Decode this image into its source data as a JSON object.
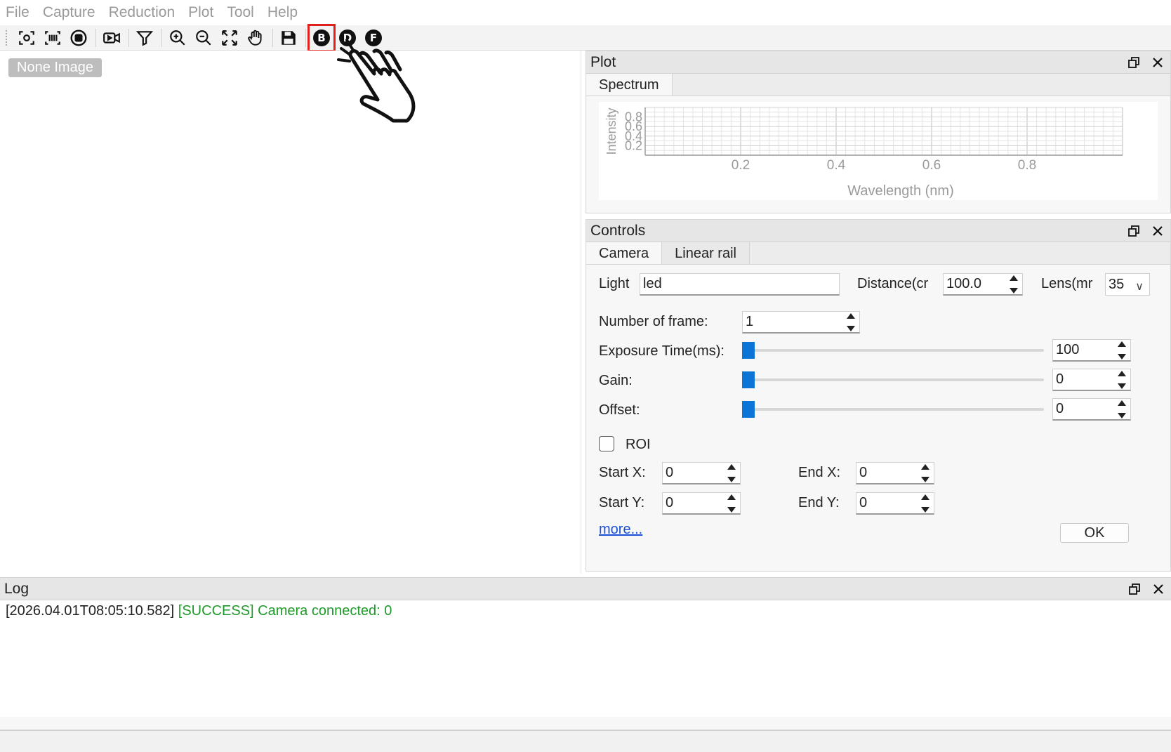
{
  "menu": [
    "File",
    "Capture",
    "Reduction",
    "Plot",
    "Tool",
    "Help"
  ],
  "toolbar": {
    "buttons": [
      "focus-capture-icon",
      "barcode-scan-icon",
      "stop-circle-icon",
      "video-record-icon",
      "filter-icon",
      "zoom-in-icon",
      "zoom-out-icon",
      "fit-screen-icon",
      "pan-hand-icon",
      "save-icon"
    ],
    "letter_b": "B",
    "letter_d": "D",
    "letter_f": "F"
  },
  "image_area": {
    "badge": "None Image"
  },
  "plot_panel": {
    "title": "Plot",
    "tab": "Spectrum",
    "chart_data": {
      "type": "line",
      "xlabel": "Wavelength (nm)",
      "ylabel": "Intensity",
      "xlim": [
        0,
        1
      ],
      "ylim": [
        0,
        1
      ],
      "xticks": [
        "0.2",
        "0.4",
        "0.6",
        "0.8"
      ],
      "yticks": [
        "0.2",
        "0.4",
        "0.6",
        "0.8"
      ],
      "grid": true,
      "series": []
    }
  },
  "controls_panel": {
    "title": "Controls",
    "tabs": [
      "Camera",
      "Linear rail"
    ],
    "light_label": "Light",
    "light_value": "led",
    "distance_label": "Distance(cr",
    "distance_value": "100.0",
    "lens_label": "Lens(mr",
    "lens_value": "35",
    "frames_label": "Number of frame:",
    "frames_value": "1",
    "exposure_label": "Exposure Time(ms):",
    "exposure_value": "100",
    "exposure_slider_fraction": 0.0,
    "gain_label": "Gain:",
    "gain_value": "0",
    "offset_label": "Offset:",
    "offset_value": "0",
    "roi_label": "ROI",
    "start_x_label": "Start X:",
    "start_x_value": "0",
    "end_x_label": "End X:",
    "end_x_value": "0",
    "start_y_label": "Start Y:",
    "start_y_value": "0",
    "end_y_label": "End Y:",
    "end_y_value": "0",
    "more_link": "more...",
    "ok_button": "OK"
  },
  "log_panel": {
    "title": "Log",
    "entries": [
      {
        "timestamp": "[2026.04.01T08:05:10.582]",
        "message": "[SUCCESS] Camera connected: 0"
      }
    ]
  }
}
